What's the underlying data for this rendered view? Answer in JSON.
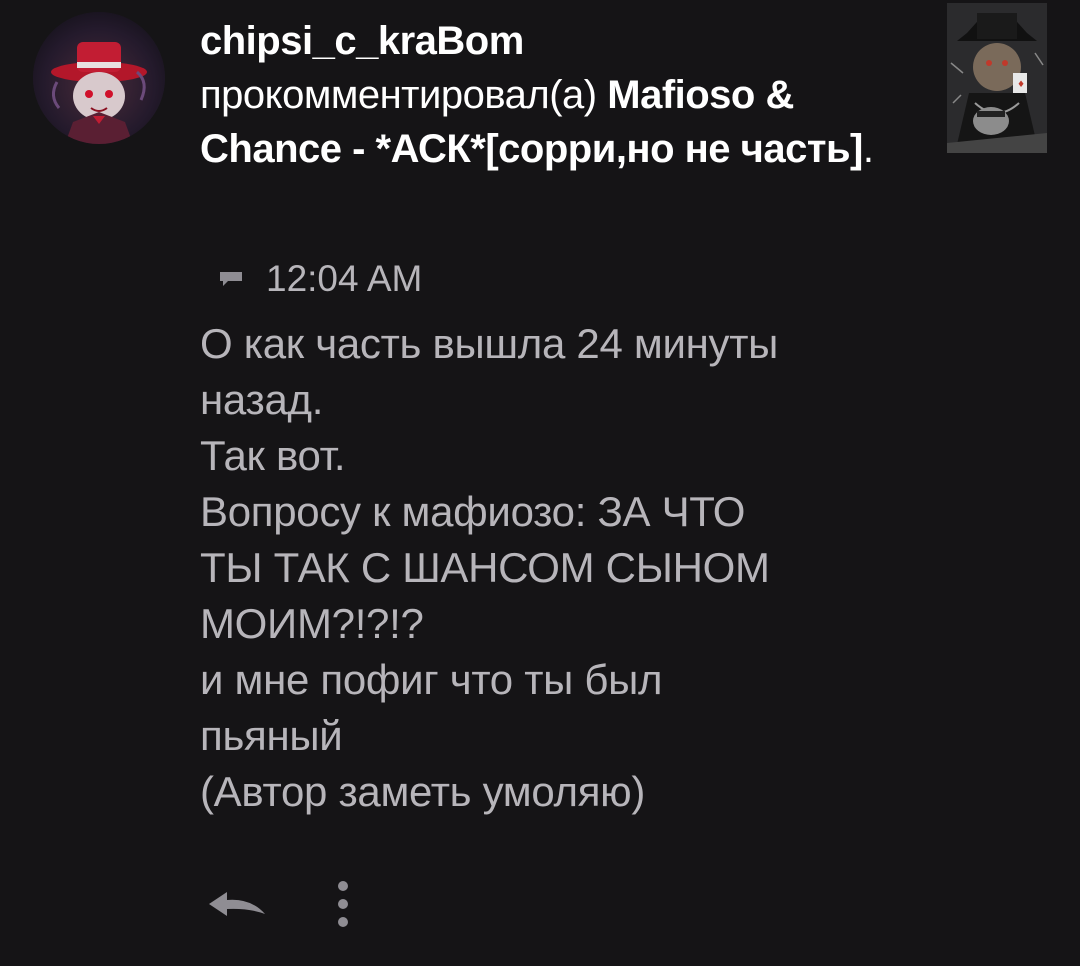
{
  "notification": {
    "username": "chipsi_c_kraBom",
    "action_text": "прокомментировал(а)",
    "post_title": "Mafioso & Chance - *АСК*[сорри,но не часть]",
    "trailing_dot": ".",
    "time": "12:04 AM",
    "comment_lines": [
      "О как часть вышла 24 минуты",
      "назад.",
      "Так вот.",
      "Вопросу к мафиозо: ЗА ЧТО",
      "ТЫ ТАК С ШАНСОМ СЫНОМ",
      "МОИМ?!?!?",
      "и мне пофиг что ты был",
      "пьяный",
      "(Автор заметь умоляю)"
    ],
    "icons": {
      "comment": "comment-icon",
      "reply": "reply-icon",
      "more": "more-vertical-icon"
    }
  },
  "colors": {
    "background": "#151416",
    "primary_text": "#ffffff",
    "secondary_text": "#b7b5ba"
  }
}
